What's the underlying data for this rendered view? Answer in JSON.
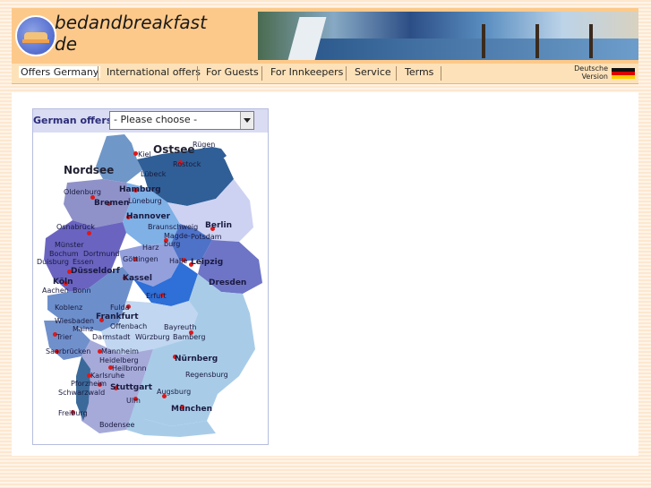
{
  "header": {
    "logo_line1": "bedandbreakfast",
    "logo_line2": "de",
    "accent": "#fdc98a"
  },
  "nav": {
    "items": [
      {
        "label": "Offers Germany",
        "key": "offers-germany"
      },
      {
        "label": "International offers",
        "key": "international-offers"
      },
      {
        "label": "For Guests",
        "key": "for-guests"
      },
      {
        "label": "For Innkeepers",
        "key": "for-innkeepers"
      },
      {
        "label": "Service",
        "key": "service"
      },
      {
        "label": "Terms",
        "key": "terms"
      }
    ],
    "language_line1": "Deutsche",
    "language_line2": "Version",
    "language_icon": "german-flag-icon"
  },
  "panel": {
    "title": "German offers",
    "select_value": "- Please choose -"
  },
  "map": {
    "seas": [
      "Nordsee",
      "Ostsee"
    ],
    "cities": [
      {
        "name": "Rügen"
      },
      {
        "name": "Kiel"
      },
      {
        "name": "Rostock"
      },
      {
        "name": "Lübeck"
      },
      {
        "name": "Oldenburg"
      },
      {
        "name": "Hamburg"
      },
      {
        "name": "Lüneburg"
      },
      {
        "name": "Bremen"
      },
      {
        "name": "Hannover"
      },
      {
        "name": "Berlin"
      },
      {
        "name": "Osnabrück"
      },
      {
        "name": "Braunschweig"
      },
      {
        "name": "Potsdam"
      },
      {
        "name": "Magde-burg"
      },
      {
        "name": "Münster"
      },
      {
        "name": "Bochum"
      },
      {
        "name": "Dortmund"
      },
      {
        "name": "Duisburg"
      },
      {
        "name": "Essen"
      },
      {
        "name": "Harz"
      },
      {
        "name": "Düsseldorf"
      },
      {
        "name": "Göttingen"
      },
      {
        "name": "Halle"
      },
      {
        "name": "Leipzig"
      },
      {
        "name": "Köln"
      },
      {
        "name": "Kassel"
      },
      {
        "name": "Aachen"
      },
      {
        "name": "Bonn"
      },
      {
        "name": "Dresden"
      },
      {
        "name": "Erfurt"
      },
      {
        "name": "Koblenz"
      },
      {
        "name": "Fulda"
      },
      {
        "name": "Frankfurt"
      },
      {
        "name": "Wiesbaden"
      },
      {
        "name": "Offenbach"
      },
      {
        "name": "Mainz"
      },
      {
        "name": "Bayreuth"
      },
      {
        "name": "Trier"
      },
      {
        "name": "Darmstadt"
      },
      {
        "name": "Würzburg"
      },
      {
        "name": "Bamberg"
      },
      {
        "name": "Saarbrücken"
      },
      {
        "name": "Mannheim"
      },
      {
        "name": "Heidelberg"
      },
      {
        "name": "Heilbronn"
      },
      {
        "name": "Nürnberg"
      },
      {
        "name": "Karlsruhe"
      },
      {
        "name": "Regensburg"
      },
      {
        "name": "Pforzheim"
      },
      {
        "name": "Stuttgart"
      },
      {
        "name": "Schwarzwald"
      },
      {
        "name": "Augsburg"
      },
      {
        "name": "Ulm"
      },
      {
        "name": "München"
      },
      {
        "name": "Freiburg"
      },
      {
        "name": "Bodensee"
      }
    ]
  }
}
